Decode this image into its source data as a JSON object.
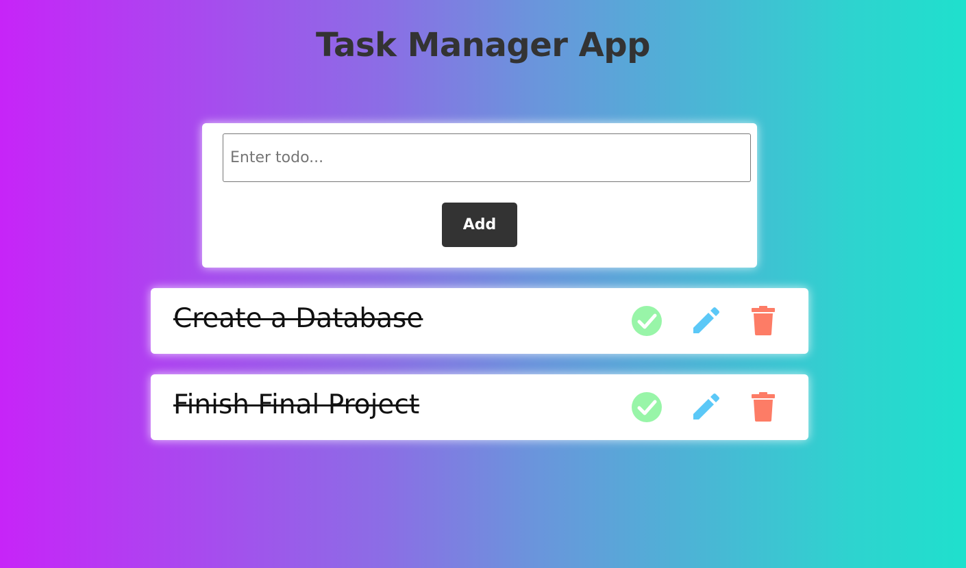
{
  "app": {
    "title": "Task Manager App"
  },
  "form": {
    "input_placeholder": "Enter todo...",
    "input_value": "",
    "add_label": "Add"
  },
  "tasks": [
    {
      "text": "Create a Database",
      "completed": true
    },
    {
      "text": "Finish Final Project",
      "completed": true
    }
  ],
  "icons": {
    "complete": "check-circle-icon",
    "edit": "pencil-icon",
    "delete": "trash-icon"
  },
  "colors": {
    "check": "#98f5a8",
    "edit": "#5bc8f7",
    "delete": "#fd7c66",
    "button": "#333333"
  }
}
